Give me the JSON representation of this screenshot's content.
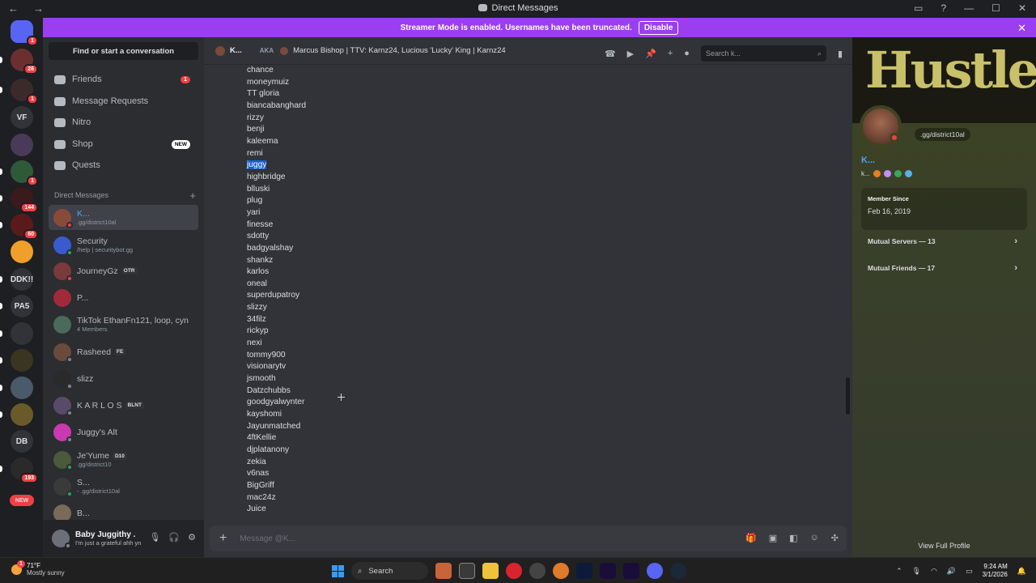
{
  "window": {
    "title": "Direct Messages"
  },
  "banner": {
    "text": "Streamer Mode is enabled. Usernames have been truncated.",
    "button": "Disable"
  },
  "rail": [
    {
      "label": "",
      "badge": "1"
    },
    {
      "label": "",
      "badge": "26"
    },
    {
      "label": "",
      "badge": "1"
    },
    {
      "label": "VF",
      "badge": ""
    },
    {
      "label": "",
      "badge": ""
    },
    {
      "label": "",
      "badge": "1"
    },
    {
      "label": "",
      "badge": "144"
    },
    {
      "label": "",
      "badge": "60"
    },
    {
      "label": "",
      "badge": ""
    },
    {
      "label": "DDK!!",
      "badge": ""
    },
    {
      "label": "PA5",
      "badge": ""
    },
    {
      "label": "",
      "badge": ""
    },
    {
      "label": "",
      "badge": ""
    },
    {
      "label": "",
      "badge": ""
    },
    {
      "label": "",
      "badge": ""
    },
    {
      "label": "DB",
      "badge": ""
    },
    {
      "label": "",
      "badge": "193"
    },
    {
      "label": "NEW",
      "badge": ""
    }
  ],
  "sidebar": {
    "find": "Find or start a conversation",
    "nav": [
      {
        "label": "Friends",
        "badge": "1",
        "new": ""
      },
      {
        "label": "Message Requests",
        "badge": "",
        "new": ""
      },
      {
        "label": "Nitro",
        "badge": "",
        "new": ""
      },
      {
        "label": "Shop",
        "badge": "",
        "new": "NEW"
      },
      {
        "label": "Quests",
        "badge": "",
        "new": ""
      }
    ],
    "dm_header": "Direct Messages",
    "dms": [
      {
        "name": "K...",
        "sub": ".gg/district10al",
        "tag": ""
      },
      {
        "name": "Security",
        "sub": "/help | securitybot.gg",
        "tag": ""
      },
      {
        "name": "JourneyGz",
        "sub": "",
        "tag": "OTR"
      },
      {
        "name": "P...",
        "sub": "",
        "tag": ""
      },
      {
        "name": "TikTok EthanFn121, loop, cyn",
        "sub": "4 Members",
        "tag": ""
      },
      {
        "name": "Rasheed",
        "sub": "",
        "tag": "FE"
      },
      {
        "name": "slizz",
        "sub": "",
        "tag": ""
      },
      {
        "name": "K A R L O S",
        "sub": "",
        "tag": "BLNT"
      },
      {
        "name": "Juggy's Alt",
        "sub": "",
        "tag": ""
      },
      {
        "name": "Je'Yume",
        "sub": ".gg/district10",
        "tag": "D10"
      },
      {
        "name": "S...",
        "sub": "- .gg/district10al",
        "tag": ""
      },
      {
        "name": "B...",
        "sub": "",
        "tag": ""
      }
    ]
  },
  "user": {
    "name": "Baby Juggithy .",
    "status": "I'm just a grateful ahh yn"
  },
  "chat": {
    "header_name": "K...",
    "aka": "AKA",
    "aka_names": "Marcus Bishop | TTV: Karnz24, Lucious 'Lucky' King | Karnz24",
    "search_placeholder": "Search k...",
    "names": [
      "chance",
      "moneymuiz",
      "TT gloria",
      "biancabanghard",
      "rizzy",
      "benji",
      "kaleema",
      "remi",
      "juggy",
      "highbridge",
      "blluski",
      "plug",
      "yari",
      "finesse",
      "sdotty",
      "badgyalshay",
      "shankz",
      "karlos",
      "oneal",
      "superdupatroy",
      "slizzy",
      "34filz",
      "rickyp",
      "nexi",
      "tommy900",
      "visionarytv",
      "jsmooth",
      "Datzchubbs",
      "goodgyalwynter",
      "kayshomi",
      "Jayunmatched",
      "4ftKellie",
      "djplatanony",
      "zekia",
      "v6nas",
      "BigGriff",
      "mac24z",
      "Juice"
    ],
    "highlighted": "juggy",
    "composer_placeholder": "Message @K..."
  },
  "profile": {
    "banner_text": "Hustlerz",
    "bubble": ".gg/district10al",
    "name": "K...",
    "username": "k...",
    "member_since_label": "Member Since",
    "member_since": "Feb 16, 2019",
    "mutual_servers": "Mutual Servers — 13",
    "mutual_friends": "Mutual Friends — 17",
    "view_full": "View Full Profile"
  },
  "taskbar": {
    "temp": "71°F",
    "weather": "Mostly sunny",
    "weather_badge": "1",
    "search": "Search",
    "time": "9:24 AM",
    "date": "3/1/2026"
  }
}
